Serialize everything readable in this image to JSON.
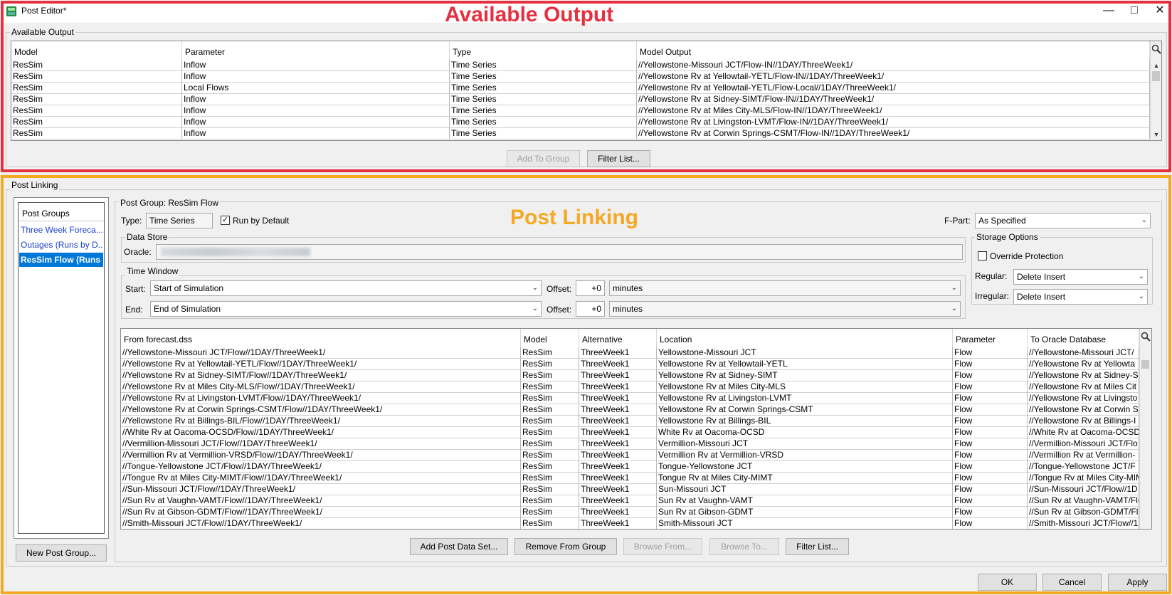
{
  "window": {
    "title": "Post Editor*",
    "colors": {
      "annotation_red": "#e53040",
      "annotation_orange": "#f6a823",
      "selection_blue": "#0078d7",
      "link_blue": "#1a3fd0"
    },
    "controls": [
      "minimize-icon",
      "maximize-icon",
      "close-icon"
    ]
  },
  "annotations": {
    "available_output": "Available Output",
    "post_linking": "Post Linking"
  },
  "available_output": {
    "group_label": "Available Output",
    "columns": [
      "Model",
      "Parameter",
      "Type",
      "Model Output"
    ],
    "rows": [
      [
        "ResSim",
        "Inflow",
        "Time Series",
        "//Yellowstone-Missouri JCT/Flow-IN//1DAY/ThreeWeek1/"
      ],
      [
        "ResSim",
        "Inflow",
        "Time Series",
        "//Yellowstone Rv at Yellowtail-YETL/Flow-IN//1DAY/ThreeWeek1/"
      ],
      [
        "ResSim",
        "Local Flows",
        "Time Series",
        "//Yellowstone Rv at Yellowtail-YETL/Flow-Local//1DAY/ThreeWeek1/"
      ],
      [
        "ResSim",
        "Inflow",
        "Time Series",
        "//Yellowstone Rv at Sidney-SIMT/Flow-IN//1DAY/ThreeWeek1/"
      ],
      [
        "ResSim",
        "Inflow",
        "Time Series",
        "//Yellowstone Rv at Miles City-MLS/Flow-IN//1DAY/ThreeWeek1/"
      ],
      [
        "ResSim",
        "Inflow",
        "Time Series",
        "//Yellowstone Rv at Livingston-LVMT/Flow-IN//1DAY/ThreeWeek1/"
      ],
      [
        "ResSim",
        "Inflow",
        "Time Series",
        "//Yellowstone Rv at Corwin Springs-CSMT/Flow-IN//1DAY/ThreeWeek1/"
      ]
    ],
    "buttons": {
      "add_to_group": "Add To Group",
      "filter_list": "Filter List..."
    }
  },
  "post_linking": {
    "group_label": "Post Linking",
    "post_groups": {
      "header": "Post Groups",
      "items": [
        "Three Week Foreca...",
        "Outages (Runs by D...",
        "ResSim Flow (Runs"
      ],
      "selected_index": 2,
      "new_button": "New Post Group..."
    },
    "post_group": {
      "label": "Post Group: ResSim Flow",
      "type_label": "Type:",
      "type_value": "Time Series",
      "run_by_default_label": "Run by Default",
      "run_by_default_checked": true,
      "fpart_label": "F-Part:",
      "fpart_value": "As Specified"
    },
    "data_store": {
      "label": "Data Store",
      "oracle_label": "Oracle:"
    },
    "storage_options": {
      "label": "Storage Options",
      "override_protection_label": "Override Protection",
      "override_protection_checked": false,
      "regular_label": "Regular:",
      "regular_value": "Delete Insert",
      "irregular_label": "Irregular:",
      "irregular_value": "Delete Insert"
    },
    "time_window": {
      "label": "Time Window",
      "start_label": "Start:",
      "start_value": "Start of Simulation",
      "end_label": "End:",
      "end_value": "End of Simulation",
      "offset_label": "Offset:",
      "start_offset": "+0",
      "end_offset": "+0",
      "start_units": "minutes",
      "end_units": "minutes"
    },
    "table": {
      "columns": [
        "From forecast.dss",
        "Model",
        "Alternative",
        "Location",
        "Parameter",
        "To Oracle Database"
      ],
      "rows": [
        [
          "//Yellowstone-Missouri JCT/Flow//1DAY/ThreeWeek1/",
          "ResSim",
          "ThreeWeek1",
          "Yellowstone-Missouri JCT",
          "Flow",
          "//Yellowstone-Missouri JCT/"
        ],
        [
          "//Yellowstone Rv at Yellowtail-YETL/Flow//1DAY/ThreeWeek1/",
          "ResSim",
          "ThreeWeek1",
          "Yellowstone Rv at Yellowtail-YETL",
          "Flow",
          "//Yellowstone Rv at Yellowta"
        ],
        [
          "//Yellowstone Rv at Sidney-SIMT/Flow//1DAY/ThreeWeek1/",
          "ResSim",
          "ThreeWeek1",
          "Yellowstone Rv at Sidney-SIMT",
          "Flow",
          "//Yellowstone Rv at Sidney-S"
        ],
        [
          "//Yellowstone Rv at Miles City-MLS/Flow//1DAY/ThreeWeek1/",
          "ResSim",
          "ThreeWeek1",
          "Yellowstone Rv at Miles City-MLS",
          "Flow",
          "//Yellowstone Rv at Miles Cit"
        ],
        [
          "//Yellowstone Rv at Livingston-LVMT/Flow//1DAY/ThreeWeek1/",
          "ResSim",
          "ThreeWeek1",
          "Yellowstone Rv at Livingston-LVMT",
          "Flow",
          "//Yellowstone Rv at Livingsto"
        ],
        [
          "//Yellowstone Rv at Corwin Springs-CSMT/Flow//1DAY/ThreeWeek1/",
          "ResSim",
          "ThreeWeek1",
          "Yellowstone Rv at Corwin Springs-CSMT",
          "Flow",
          "//Yellowstone Rv at Corwin S"
        ],
        [
          "//Yellowstone Rv at Billings-BIL/Flow//1DAY/ThreeWeek1/",
          "ResSim",
          "ThreeWeek1",
          "Yellowstone Rv at Billings-BIL",
          "Flow",
          "//Yellowstone Rv at Billings-I"
        ],
        [
          "//White Rv at Oacoma-OCSD/Flow//1DAY/ThreeWeek1/",
          "ResSim",
          "ThreeWeek1",
          "White Rv at Oacoma-OCSD",
          "Flow",
          "//White Rv at Oacoma-OCSD"
        ],
        [
          "//Vermillion-Missouri JCT/Flow//1DAY/ThreeWeek1/",
          "ResSim",
          "ThreeWeek1",
          "Vermillion-Missouri JCT",
          "Flow",
          "//Vermillion-Missouri JCT/Flo"
        ],
        [
          "//Vermillion Rv at Vermillion-VRSD/Flow//1DAY/ThreeWeek1/",
          "ResSim",
          "ThreeWeek1",
          "Vermillion Rv at Vermillion-VRSD",
          "Flow",
          "//Vermillion Rv at Vermillion-"
        ],
        [
          "//Tongue-Yellowstone JCT/Flow//1DAY/ThreeWeek1/",
          "ResSim",
          "ThreeWeek1",
          "Tongue-Yellowstone JCT",
          "Flow",
          "//Tongue-Yellowstone JCT/F"
        ],
        [
          "//Tongue Rv at Miles City-MIMT/Flow//1DAY/ThreeWeek1/",
          "ResSim",
          "ThreeWeek1",
          "Tongue Rv at Miles City-MIMT",
          "Flow",
          "//Tongue Rv at Miles City-MIM"
        ],
        [
          "//Sun-Missouri JCT/Flow//1DAY/ThreeWeek1/",
          "ResSim",
          "ThreeWeek1",
          "Sun-Missouri JCT",
          "Flow",
          "//Sun-Missouri JCT/Flow//1D"
        ],
        [
          "//Sun Rv at Vaughn-VAMT/Flow//1DAY/ThreeWeek1/",
          "ResSim",
          "ThreeWeek1",
          "Sun Rv at Vaughn-VAMT",
          "Flow",
          "//Sun Rv at Vaughn-VAMT/Flo"
        ],
        [
          "//Sun Rv at Gibson-GDMT/Flow//1DAY/ThreeWeek1/",
          "ResSim",
          "ThreeWeek1",
          "Sun Rv at Gibson-GDMT",
          "Flow",
          "//Sun Rv at Gibson-GDMT/Fl"
        ],
        [
          "//Smith-Missouri JCT/Flow//1DAY/ThreeWeek1/",
          "ResSim",
          "ThreeWeek1",
          "Smith-Missouri JCT",
          "Flow",
          "//Smith-Missouri JCT/Flow//1"
        ]
      ]
    },
    "buttons": {
      "add_post_data_set": "Add Post Data Set...",
      "remove_from_group": "Remove From Group",
      "browse_from": "Browse From...",
      "browse_to": "Browse To...",
      "filter_list": "Filter List..."
    }
  },
  "dialog_buttons": {
    "ok": "OK",
    "cancel": "Cancel",
    "apply": "Apply"
  }
}
